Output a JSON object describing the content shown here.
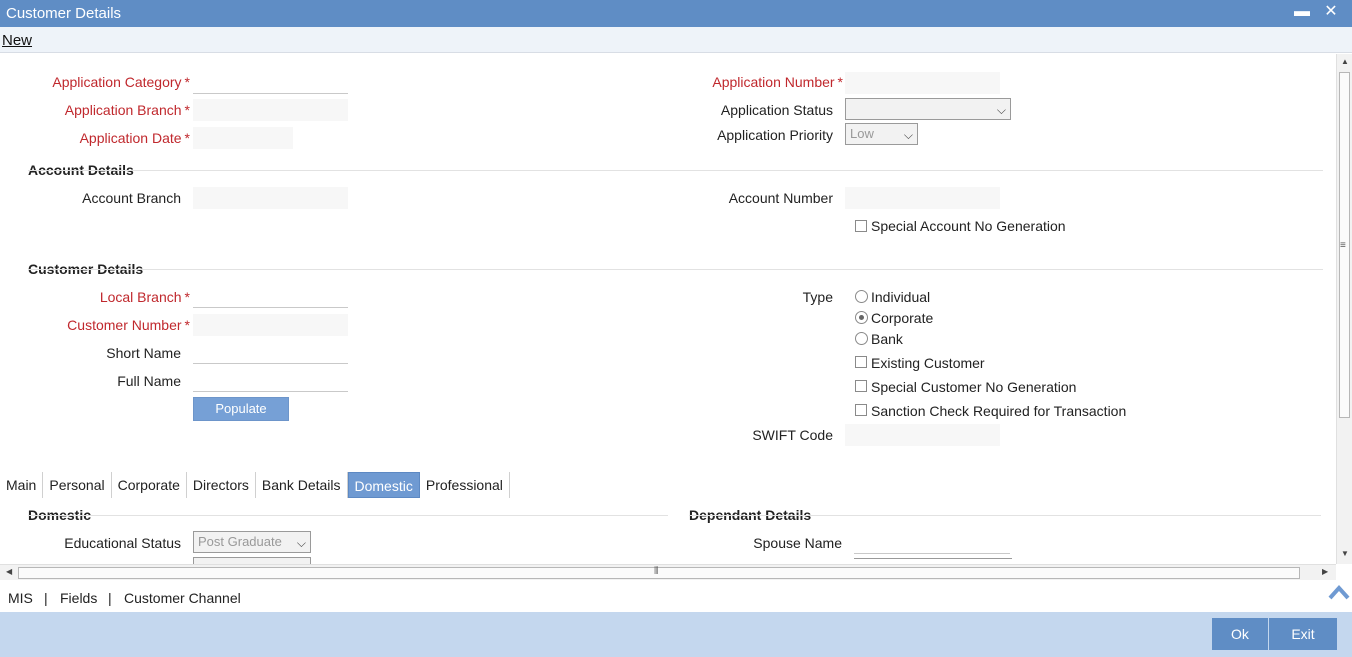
{
  "window": {
    "title": "Customer Details",
    "minimize_glyph": "▬",
    "close_glyph": "✕"
  },
  "menu": {
    "new_label": "New"
  },
  "application": {
    "category_label": "Application Category",
    "branch_label": "Application Branch",
    "date_label": "Application Date",
    "number_label": "Application Number",
    "status_label": "Application Status",
    "status_value": "",
    "priority_label": "Application Priority",
    "priority_value": "Low",
    "required_mark": "*"
  },
  "account_details": {
    "title": "Account Details",
    "branch_label": "Account Branch",
    "number_label": "Account Number",
    "special_no_label": "Special Account No Generation"
  },
  "customer_details": {
    "title": "Customer Details",
    "local_branch_label": "Local Branch",
    "customer_number_label": "Customer Number",
    "short_name_label": "Short Name",
    "full_name_label": "Full Name",
    "populate_label": "Populate",
    "type_label": "Type",
    "type_options": [
      "Individual",
      "Corporate",
      "Bank"
    ],
    "type_selected": "Corporate",
    "existing_customer_label": "Existing Customer",
    "special_customer_label": "Special Customer No Generation",
    "sanction_check_label": "Sanction Check Required for Transaction",
    "swift_label": "SWIFT Code"
  },
  "tabs": [
    "Main",
    "Personal",
    "Corporate",
    "Directors",
    "Bank Details",
    "Domestic",
    "Professional"
  ],
  "active_tab": "Domestic",
  "domestic": {
    "title": "Domestic",
    "educational_status_label": "Educational Status",
    "educational_status_value": "Post Graduate"
  },
  "dependant": {
    "title": "Dependant Details",
    "spouse_name_label": "Spouse Name"
  },
  "bottom_links": {
    "mis": "MIS",
    "fields": "Fields",
    "channel": "Customer Channel",
    "separator": "|"
  },
  "footer": {
    "ok": "Ok",
    "exit": "Exit"
  },
  "colors": {
    "title_bar": "#5f8dc5",
    "required": "#c0282d",
    "active_tab": "#6f9ad2",
    "footer": "#c4d7ee"
  }
}
